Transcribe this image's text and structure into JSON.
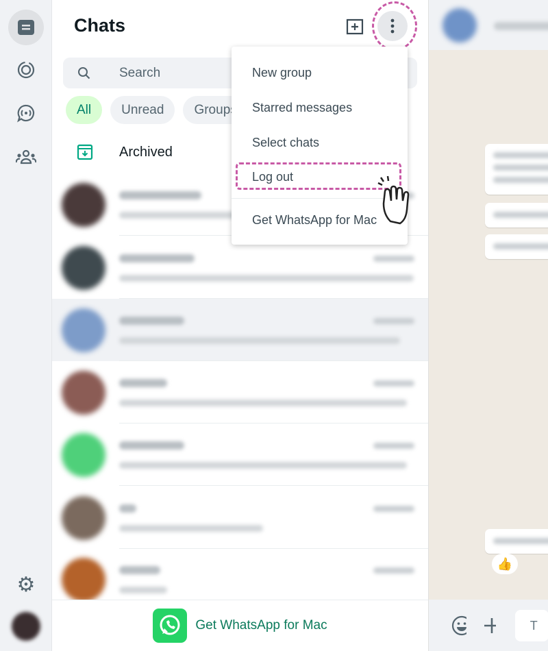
{
  "rail": {
    "icons": [
      "chats-icon",
      "status-icon",
      "channels-icon",
      "communities-icon",
      "settings-icon",
      "profile-avatar"
    ]
  },
  "header": {
    "title": "Chats",
    "new_chat_icon": "new-chat-icon",
    "menu_icon": "kebab-menu-icon"
  },
  "search": {
    "placeholder": "Search"
  },
  "filters": [
    {
      "label": "All",
      "active": true
    },
    {
      "label": "Unread"
    },
    {
      "label": "Groups"
    }
  ],
  "archived": {
    "label": "Archived"
  },
  "chats": [
    {
      "avatar_color": "#4a3a3a"
    },
    {
      "avatar_color": "#3f4a4f"
    },
    {
      "avatar_color": "#7d9cc9",
      "selected": true
    },
    {
      "avatar_color": "#8b5c55"
    },
    {
      "avatar_color": "#4fd07a"
    },
    {
      "avatar_color": "#7b6a5e"
    },
    {
      "avatar_color": "#b4622a"
    }
  ],
  "footer": {
    "label": "Get WhatsApp for Mac"
  },
  "menu": {
    "items": [
      "New group",
      "Starred messages",
      "Select chats",
      "Log out",
      "Get WhatsApp for Mac"
    ],
    "highlighted": "Log out"
  },
  "conversation": {
    "reaction": "👍",
    "input_placeholder_visible": "T"
  },
  "colors": {
    "accent": "#008069",
    "highlight": "#c85aa6",
    "pane_bg": "#efeae2"
  }
}
